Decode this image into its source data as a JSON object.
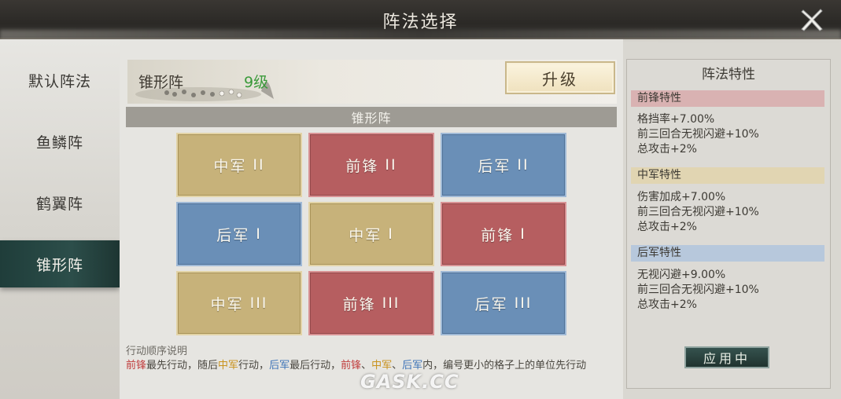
{
  "header": {
    "title": "阵法选择"
  },
  "tabs": [
    {
      "label": "默认阵法"
    },
    {
      "label": "鱼鳞阵"
    },
    {
      "label": "鹤翼阵"
    },
    {
      "label": "锥形阵",
      "active": true
    }
  ],
  "formation": {
    "name": "锥形阵",
    "level": "9级",
    "upgrade_label": "升级",
    "grid_title": "锥形阵"
  },
  "grid": [
    [
      {
        "label": "中军",
        "numeral": "II",
        "kind": "zhong"
      },
      {
        "label": "前锋",
        "numeral": "II",
        "kind": "qian"
      },
      {
        "label": "后军",
        "numeral": "II",
        "kind": "hou"
      }
    ],
    [
      {
        "label": "后军",
        "numeral": "I",
        "kind": "hou"
      },
      {
        "label": "中军",
        "numeral": "I",
        "kind": "zhong"
      },
      {
        "label": "前锋",
        "numeral": "I",
        "kind": "qian"
      }
    ],
    [
      {
        "label": "中军",
        "numeral": "III",
        "kind": "zhong"
      },
      {
        "label": "前锋",
        "numeral": "III",
        "kind": "qian"
      },
      {
        "label": "后军",
        "numeral": "III",
        "kind": "hou"
      }
    ]
  ],
  "order": {
    "title": "行动顺序说明",
    "p1": "前锋",
    "p2": "最先行动，随后",
    "p3": "中军",
    "p4": "行动，",
    "p5": "后军",
    "p6": "最后行动，",
    "p7": "前锋",
    "p8": "、",
    "p9": "中军",
    "p10": "、",
    "p11": "后军",
    "p12": "内，编号更小的格子上的单位先行动"
  },
  "traits": {
    "title": "阵法特性",
    "vanguard": {
      "head": "前锋特性",
      "lines": [
        "格挡率+7.00%",
        "前三回合无视闪避+10%",
        "总攻击+2%"
      ]
    },
    "center": {
      "head": "中军特性",
      "lines": [
        "伤害加成+7.00%",
        "前三回合无视闪避+10%",
        "总攻击+2%"
      ]
    },
    "rear": {
      "head": "后军特性",
      "lines": [
        "无视闪避+9.00%",
        "前三回合无视闪避+10%",
        "总攻击+2%"
      ]
    },
    "apply_label": "应用中"
  },
  "watermark": "GASK.CC",
  "colors": {
    "zhong": "#c7b27a",
    "qian": "#b65e60",
    "hou": "#6a8fb7",
    "active_tab": "#1f3d3a"
  }
}
